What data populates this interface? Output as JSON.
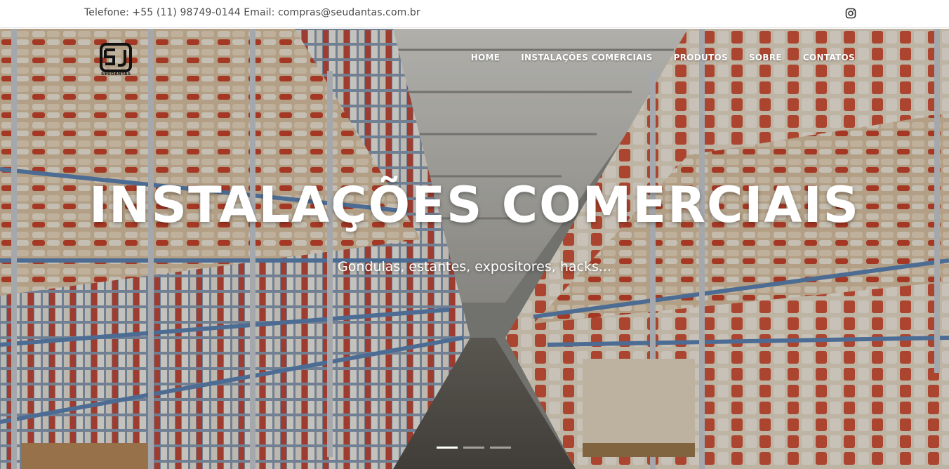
{
  "topbar": {
    "contact": "Telefone: +55 (11) 98749-0144 Email: compras@seudantas.com.br"
  },
  "brand": {
    "wordmark": "SEUDANTAS"
  },
  "nav": {
    "items": [
      {
        "label": "HOME"
      },
      {
        "label": "INSTALAÇÕES COMERCIAIS"
      },
      {
        "label": "PRODUTOS"
      },
      {
        "label": "SOBRE"
      },
      {
        "label": "CONTATOS"
      }
    ]
  },
  "hero": {
    "title": "INSTALAÇÕES COMERCIAIS",
    "subtitle": "Gondulas, estantes, expositores, hacks..."
  },
  "carousel": {
    "slide_count": 3,
    "active_index": 0
  },
  "icons": {
    "social": "instagram-icon",
    "logo": "seudantas-logo"
  },
  "colors": {
    "topbar_text": "#4a4a4a",
    "hero_text": "#ffffff",
    "nav_text": "#ffffff"
  }
}
